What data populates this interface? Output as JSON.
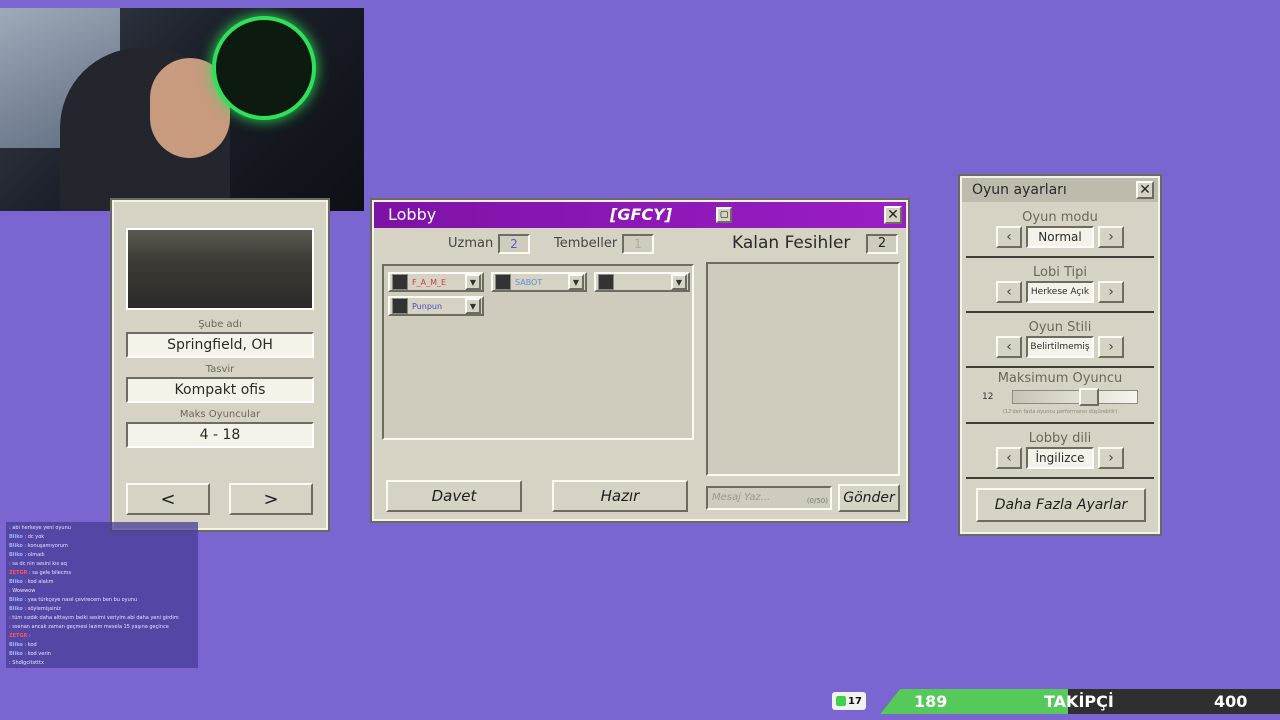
{
  "webcam": {
    "label": ""
  },
  "office_panel": {
    "branch_label": "Şube adı",
    "branch_value": "Springfield, OH",
    "description_label": "Tasvir",
    "description_value": "Kompakt ofis",
    "max_players_label": "Maks Oyuncular",
    "max_players_value": "4 - 18",
    "prev": "<",
    "next": ">"
  },
  "lobby": {
    "title": "Lobby",
    "code": "[GFCY]",
    "expert_label": "Uzman",
    "expert_value": "2",
    "lazy_label": "Tembeller",
    "lazy_value": "1",
    "kicks_label": "Kalan Fesihler",
    "kicks_value": "2",
    "players": [
      {
        "name": "F_A_M_E",
        "color": "#d23c3c"
      },
      {
        "name": "SABOT",
        "color": "#5b8fd6"
      },
      {
        "name": "",
        "color": "#6fa86f"
      },
      {
        "name": "Punpun",
        "color": "#4a48b8"
      }
    ],
    "invite_label": "Davet",
    "ready_label": "Hazır",
    "message_placeholder": "Mesaj Yaz...",
    "message_count": "(0/50)",
    "send_label": "Gönder"
  },
  "settings": {
    "title": "Oyun ayarları",
    "mode_label": "Oyun modu",
    "mode_value": "Normal",
    "lobby_type_label": "Lobi Tipi",
    "lobby_type_value": "Herkese Açık",
    "style_label": "Oyun Stili",
    "style_value": "Belirtilmemiş",
    "max_label": "Maksimum Oyuncu",
    "max_value": "12",
    "max_fraction": 0.62,
    "max_note": "(12'den fazla oyuncu performansı düşürebilir)",
    "lang_label": "Lobby dili",
    "lang_value": "İngilizce",
    "more_label": "Daha Fazla Ayarlar"
  },
  "chat": [
    {
      "user": "",
      "msg": "abi herkeye yeni oyunu",
      "color": "#9fb6ff"
    },
    {
      "user": "Bliko",
      "msg": "dc yok",
      "color": "#9fb6ff"
    },
    {
      "user": "Bliko",
      "msg": "konuşamıyorum",
      "color": "#9fb6ff"
    },
    {
      "user": "Bliko",
      "msg": "olmadı",
      "color": "#9fb6ff"
    },
    {
      "user": "",
      "msg": "sa dc nin sesini kıs aq",
      "color": "#ff6b6b"
    },
    {
      "user": "ZETGR",
      "msg": "sa gele bilecms",
      "color": "#ff5555"
    },
    {
      "user": "Bliko",
      "msg": "kod alalım",
      "color": "#9fb6ff"
    },
    {
      "user": "",
      "msg": "Wowwow",
      "color": "#ff6b6b"
    },
    {
      "user": "Bliko",
      "msg": "yaa türkçeye nasıl çevirecem ben bu oyunu",
      "color": "#9fb6ff"
    },
    {
      "user": "Bliko",
      "msg": "söylemişsiniz",
      "color": "#9fb6ff"
    },
    {
      "user": "",
      "msg": "tüm sızdık daha alttayım belki sesimi veriyim abi daha yeni girdim",
      "color": "#ff6b6b"
    },
    {
      "user": "",
      "msg": "ssenan ancak zaman geçmesi lazım mesela 15 yaşına geçince",
      "color": "#e8e6ff"
    },
    {
      "user": "ZETGR",
      "msg": "",
      "color": "#ff5555"
    },
    {
      "user": "Bliko",
      "msg": "kod",
      "color": "#9fb6ff"
    },
    {
      "user": "Bliko",
      "msg": "kod verin",
      "color": "#9fb6ff"
    },
    {
      "user": "",
      "msg": "Shdlgcitstttx",
      "color": "#ff6b6b"
    }
  ],
  "followers": {
    "badge": "17",
    "current": "189",
    "label": "TAKİPÇİ",
    "goal": "400",
    "progress": 0.47
  }
}
